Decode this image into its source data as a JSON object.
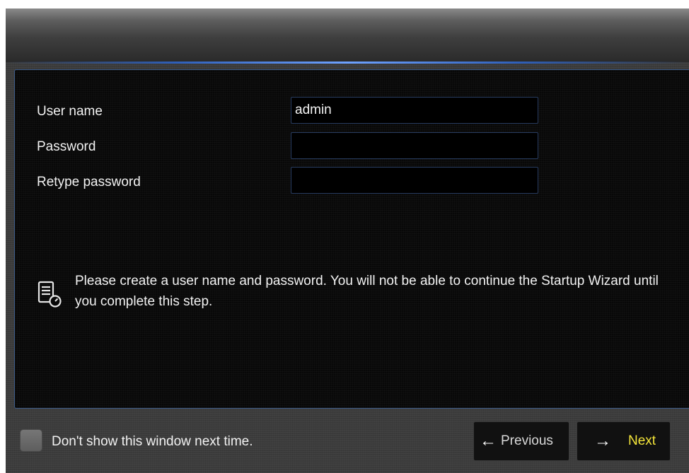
{
  "form": {
    "username_label": "User name",
    "username_value": "admin",
    "password_label": "Password",
    "password_value": "",
    "retype_label": "Retype password",
    "retype_value": ""
  },
  "info": {
    "icon": "document-settings-icon",
    "message": "Please create a user name and password. You will not be able to continue the Startup Wizard until you complete this step."
  },
  "footer": {
    "dont_show_label": "Don't show this window next time.",
    "dont_show_checked": false,
    "previous_label": "Previous",
    "previous_icon": "arrow-left-icon",
    "next_label": "Next",
    "next_icon": "arrow-right-icon"
  },
  "colors": {
    "panel_border": "#3b5a88",
    "next_text": "#f5e63a",
    "title_glow": "#6ea2ff"
  }
}
